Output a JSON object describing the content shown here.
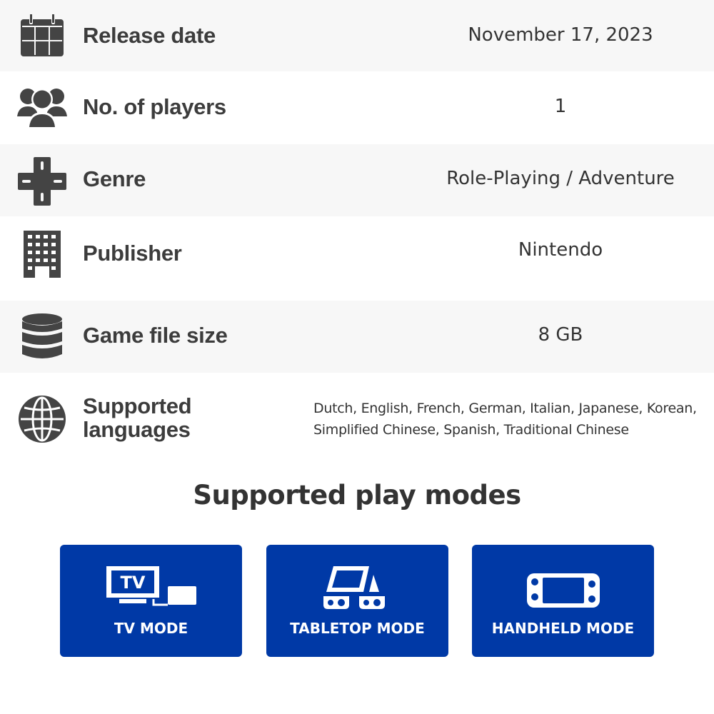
{
  "details": [
    {
      "icon": "calendar-icon",
      "label": "Release date",
      "value": "November 17, 2023"
    },
    {
      "icon": "players-icon",
      "label": "No. of players",
      "value": "1"
    },
    {
      "icon": "dpad-icon",
      "label": "Genre",
      "value": "Role-Playing / Adventure"
    },
    {
      "icon": "building-icon",
      "label": "Publisher",
      "value": "Nintendo"
    },
    {
      "icon": "database-icon",
      "label": "Game file size",
      "value": "8 GB"
    },
    {
      "icon": "globe-icon",
      "label_line1": "Supported",
      "label_line2": "languages",
      "value_line1": "Dutch, English, French, German, Italian, Japanese, Korean,",
      "value_line2": "Simplified Chinese, Spanish, Traditional Chinese"
    }
  ],
  "play_modes": {
    "title": "Supported play modes",
    "tv_icon_text": "TV",
    "modes": [
      {
        "icon": "tv-mode-icon",
        "label": "TV MODE"
      },
      {
        "icon": "tabletop-mode-icon",
        "label": "TABLETOP MODE"
      },
      {
        "icon": "handheld-mode-icon",
        "label": "HANDHELD MODE"
      }
    ]
  },
  "colors": {
    "mode_card": "#0039a6",
    "row_alt": "#f7f7f7",
    "text": "#333333"
  }
}
